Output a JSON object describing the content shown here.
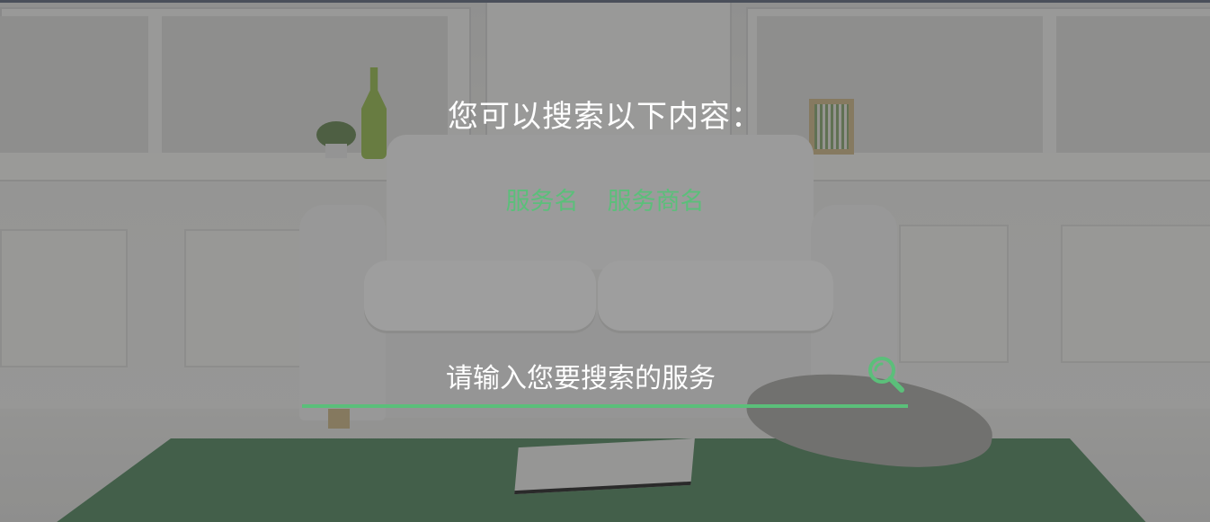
{
  "accent_color": "#5bbf7a",
  "prompt": {
    "title": "您可以搜索以下内容："
  },
  "categories": [
    {
      "label": "服务名"
    },
    {
      "label": "服务商名"
    }
  ],
  "search": {
    "placeholder": "请输入您要搜索的服务",
    "value": "",
    "icon": "search-icon"
  },
  "background": {
    "description_icon": "living-room-photo"
  }
}
